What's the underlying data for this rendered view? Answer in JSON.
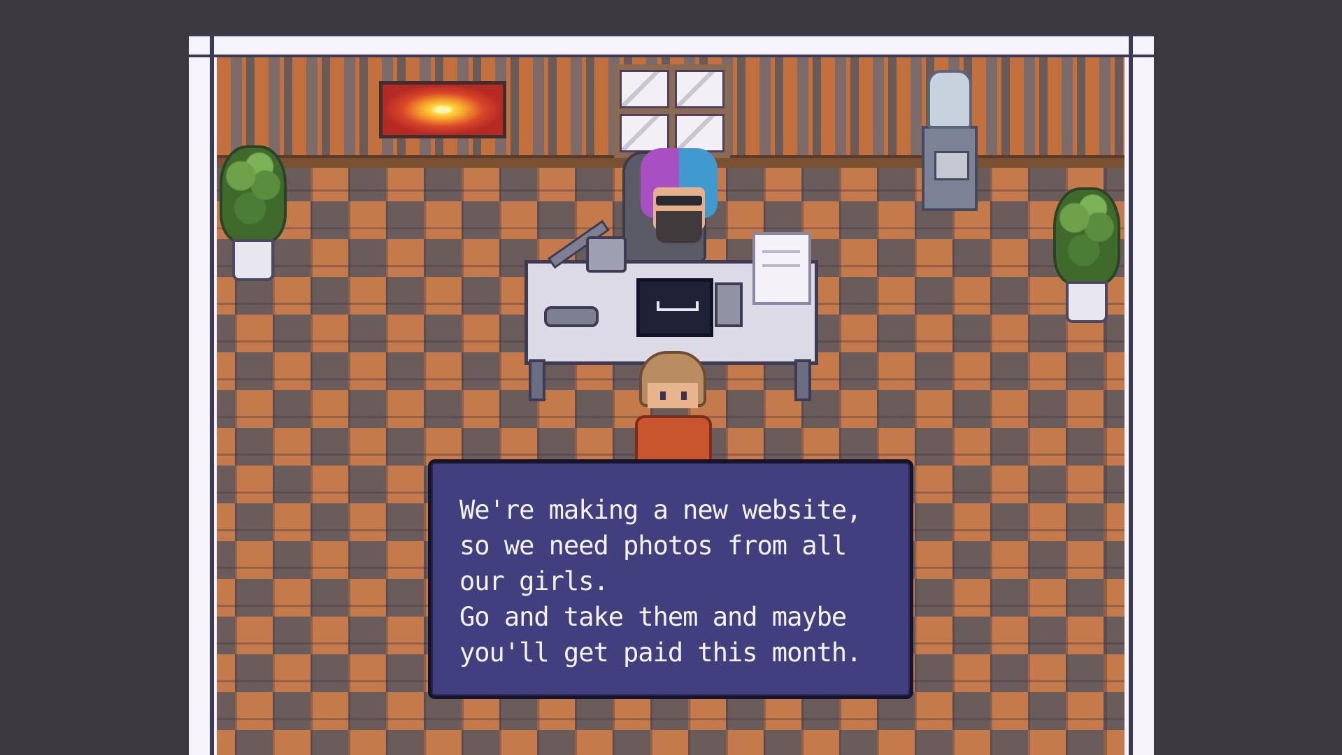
{
  "dialog": {
    "lines": [
      "We're making a new website,",
      "so we need photos from all",
      "our girls.",
      "Go and take them and maybe",
      "you'll get paid this month."
    ]
  },
  "colors": {
    "background": "#3c3a3f",
    "frame": "#f6f4fa",
    "dialog_bg": "#423f7e",
    "dialog_text": "#f4f2fa",
    "floor_light": "#c57a4c",
    "floor_dark": "#6b5c5c"
  },
  "icons": [
    "painting",
    "window",
    "water-cooler",
    "plant",
    "desk-lamp",
    "laptop",
    "papers"
  ]
}
